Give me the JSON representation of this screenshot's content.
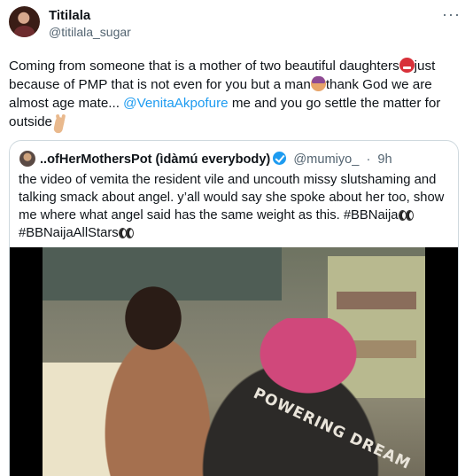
{
  "tweet": {
    "author_name": "Titilala",
    "author_handle": "@titilala_sugar",
    "text_part1": "Coming from someone that is a mother of two beautiful daughters",
    "text_part2": "just because of PMP that is not even for you but a man",
    "text_part3": "thank God we are almost age mate... ",
    "mention": "@VenitaAkpofure",
    "text_part4": " me and you go settle the matter for outside",
    "emojis": [
      "angry-face-icon",
      "facepalm-icon",
      "victory-hand-icon"
    ]
  },
  "quoted_tweet": {
    "author_name": "..ofHerMothersPot (ìdàmú everybody)",
    "author_handle": "@mumiyo_",
    "separator": "·",
    "time": "9h",
    "text_main": "the video of vemita the resident vile and uncouth missy slutshaming and talking smack about angel. y’all would say she spoke about her too, show me where what angel said has the same weight as this. #BBNaija",
    "text_tail": "#BBNaijaAllStars",
    "video_shirt_text": "POWERING DREAM"
  },
  "colors": {
    "link": "#1d9bf0",
    "secondary_text": "#536471",
    "border": "#cfd9de"
  }
}
